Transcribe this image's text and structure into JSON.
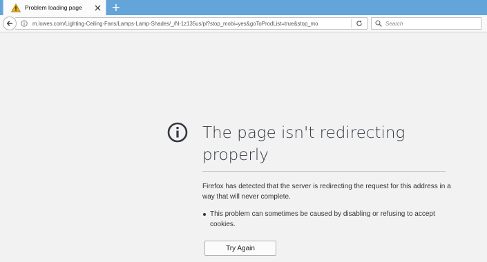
{
  "tab": {
    "title": "Problem loading page",
    "icon": "warning-icon",
    "new_tab_label": "+"
  },
  "navbar": {
    "url": "m.lowes.com/Lighting-Ceiling-Fans/Lamps-Lamp-Shades/_/N-1z135us/pl?stop_mobi=yes&goToProdList=true&stop_mo",
    "search_placeholder": "Search"
  },
  "error": {
    "title": "The page isn't redirecting properly",
    "description": "Firefox has detected that the server is redirecting the request for this address in a way that will never complete.",
    "bullets": [
      "This problem can sometimes be caused by disabling or refusing to accept cookies."
    ],
    "button_label": "Try Again"
  },
  "colors": {
    "tabstrip": "#63a5d9",
    "page_background": "#f2f2f2",
    "title_text": "#333842",
    "warning_icon": "#e8b321"
  }
}
